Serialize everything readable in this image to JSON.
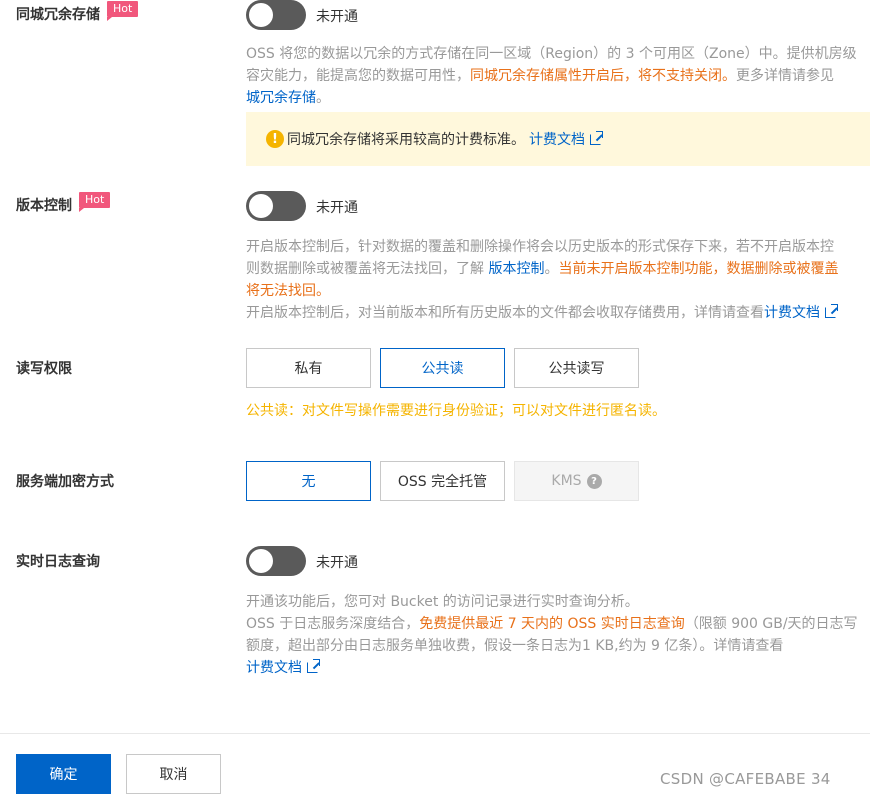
{
  "sections": {
    "redundancy": {
      "label": "同城冗余存储",
      "hot": "Hot",
      "status": "未开通",
      "desc_line1": "OSS 将您的数据以冗余的方式存储在同一区域（Region）的 3 个可用区（Zone）中。提供机房级",
      "desc_line2_a": "容灾能力，能提高您的数据可用性，",
      "desc_line2_warn": "同城冗余存储属性开启后，将不支持关闭。",
      "desc_line2_b": "更多详情请参见",
      "desc_line3_link": "城冗余存储",
      "desc_line3_end": "。",
      "notice_text": "同城冗余存储将采用较高的计费标准。",
      "notice_link": "计费文档"
    },
    "versioning": {
      "label": "版本控制",
      "hot": "Hot",
      "status": "未开通",
      "desc_line1": "开启版本控制后，针对数据的覆盖和删除操作将会以历史版本的形式保存下来，若不开启版本控",
      "desc_line2_a": "则数据删除或被覆盖将无法找回，了解 ",
      "desc_line2_link": "版本控制",
      "desc_line2_b": "。",
      "desc_line2_warn": "当前未开启版本控制功能，数据删除或被覆盖",
      "desc_line3_warn": "将无法找回。",
      "desc_line4": "开启版本控制后，对当前版本和所有历史版本的文件都会收取存储费用，详情请查看",
      "desc_line4_link": "计费文档"
    },
    "acl": {
      "label": "读写权限",
      "options": [
        "私有",
        "公共读",
        "公共读写"
      ],
      "selected": "公共读",
      "hint": "公共读：对文件写操作需要进行身份验证；可以对文件进行匿名读。"
    },
    "encryption": {
      "label": "服务端加密方式",
      "options": [
        "无",
        "OSS 完全托管",
        "KMS"
      ],
      "selected": "无",
      "disabled": "KMS"
    },
    "realtime_log": {
      "label": "实时日志查询",
      "status": "未开通",
      "desc_line1": "开通该功能后，您可对 Bucket 的访问记录进行实时查询分析。",
      "desc_line2_a": "OSS 于日志服务深度结合，",
      "desc_line2_warn": "免费提供最近 7 天内的 OSS 实时日志查询",
      "desc_line2_b": "（限额 900 GB/天的日志写",
      "desc_line3": "额度，超出部分由日志服务单独收费，假设一条日志为1 KB,约为 9 亿条）。详情请查看",
      "desc_line4_link": "计费文档"
    }
  },
  "footer": {
    "confirm": "确定",
    "cancel": "取消",
    "watermark": "CSDN @CAFEBABE 34"
  },
  "colors": {
    "primary": "#0064c8",
    "warning": "#e8711a",
    "hint": "#f5b400",
    "hot": "#f1577c"
  }
}
